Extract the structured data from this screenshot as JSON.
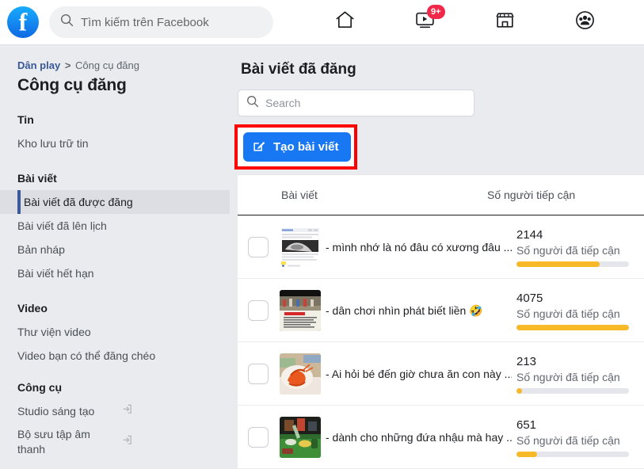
{
  "header": {
    "logo_alt": "Facebook",
    "search_placeholder": "Tìm kiếm trên Facebook",
    "nav": [
      {
        "name": "home-icon",
        "label": "Trang chủ",
        "badge": ""
      },
      {
        "name": "watch-icon",
        "label": "Video",
        "badge": "9+"
      },
      {
        "name": "marketplace-icon",
        "label": "Marketplace",
        "badge": ""
      },
      {
        "name": "groups-icon",
        "label": "Nhóm",
        "badge": ""
      }
    ]
  },
  "sidebar": {
    "breadcrumb": {
      "parent": "Dân play",
      "separator": ">",
      "current": "Công cụ đăng"
    },
    "page_title": "Công cụ đăng",
    "groups": [
      {
        "title": "Tin",
        "items": [
          {
            "label": "Kho lưu trữ tin",
            "active": false,
            "external": false
          }
        ]
      },
      {
        "title": "Bài viết",
        "items": [
          {
            "label": "Bài viết đã được đăng",
            "active": true,
            "external": false
          },
          {
            "label": "Bài viết đã lên lịch",
            "active": false,
            "external": false
          },
          {
            "label": "Bản nháp",
            "active": false,
            "external": false
          },
          {
            "label": "Bài viết hết hạn",
            "active": false,
            "external": false
          }
        ]
      },
      {
        "title": "Video",
        "items": [
          {
            "label": "Thư viện video",
            "active": false,
            "external": false
          },
          {
            "label": "Video bạn có thể đăng chéo",
            "active": false,
            "external": false
          }
        ]
      },
      {
        "title": "Công cụ",
        "items": [
          {
            "label": "Studio sáng tạo",
            "active": false,
            "external": true
          },
          {
            "label": "Bộ sưu tập âm thanh",
            "active": false,
            "external": true
          }
        ]
      }
    ]
  },
  "main": {
    "title": "Bài viết đã đăng",
    "search_placeholder": "Search",
    "search_value": "",
    "create_button": "Tạo bài viết",
    "table": {
      "columns": {
        "post": "Bài viết",
        "reach": "Số người tiếp cận"
      },
      "rows": [
        {
          "text": "- mình nhớ là nó đâu có xương đâu ...",
          "reach": "2144",
          "reach_label": "Số người đã tiếp cận",
          "bar_percent": 74,
          "checked": false,
          "thumb_kind": "screenshot-gray"
        },
        {
          "text": "- dân chơi nhìn phát biết liền 🤣",
          "reach": "4075",
          "reach_label": "Số người đã tiếp cận",
          "bar_percent": 100,
          "checked": false,
          "thumb_kind": "poster-red"
        },
        {
          "text": "- Ai hỏi bé đến giờ chưa ăn con này ...",
          "reach": "213",
          "reach_label": "Số người đã tiếp cận",
          "bar_percent": 5,
          "checked": false,
          "thumb_kind": "food-shrimp"
        },
        {
          "text": "- dành cho những đứa nhậu mà hay ...",
          "reach": "651",
          "reach_label": "Số người đã tiếp cận",
          "bar_percent": 18,
          "checked": false,
          "thumb_kind": "table-green"
        }
      ]
    }
  },
  "annotation": {
    "highlight_color": "#ff0000",
    "target": "Tạo bài viết"
  },
  "colors": {
    "brand_blue": "#1877f2",
    "page_bg": "#e9ebee",
    "bar_amber": "#f7b928",
    "badge_red": "#f02849",
    "active_bar": "#3b5998"
  }
}
